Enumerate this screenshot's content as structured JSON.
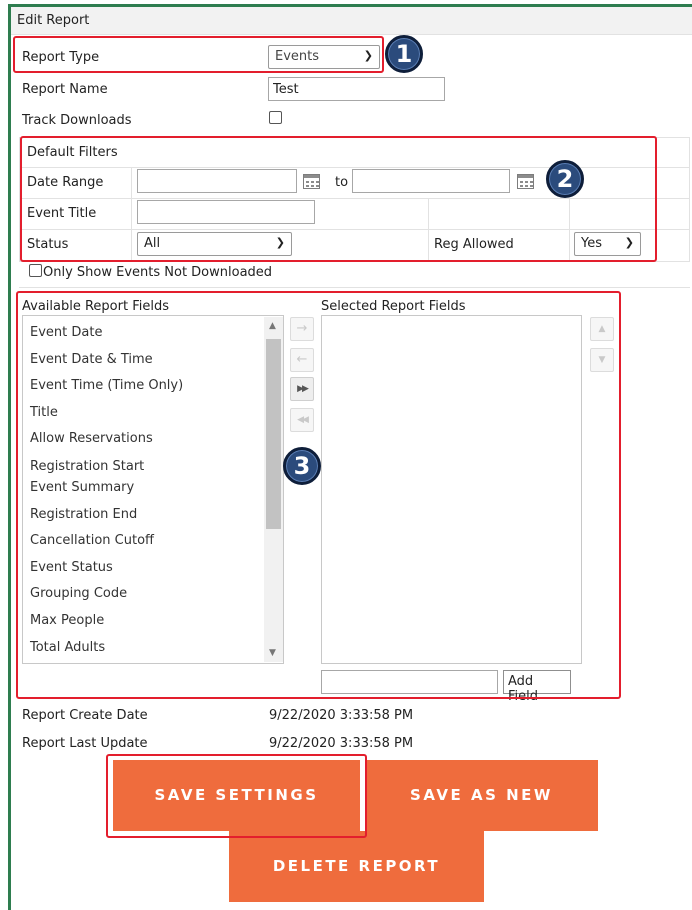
{
  "panel": {
    "title": "Edit Report"
  },
  "report_type": {
    "label": "Report Type",
    "value": "Events"
  },
  "report_name": {
    "label": "Report Name",
    "value": "Test"
  },
  "track_downloads": {
    "label": "Track Downloads",
    "checked": false
  },
  "filters": {
    "heading": "Default Filters",
    "date_range": {
      "label": "Date Range",
      "from_value": "",
      "to_label": "to",
      "to_value": ""
    },
    "event_title": {
      "label": "Event Title",
      "value": ""
    },
    "status": {
      "label": "Status",
      "value": "All"
    },
    "reg_allowed": {
      "label": "Reg Allowed",
      "value": "Yes"
    }
  },
  "only_not_downloaded": {
    "label": "Only Show Events Not Downloaded",
    "checked": false
  },
  "available_fields": {
    "heading": "Available Report Fields",
    "items": [
      "Event Date",
      "Event Date & Time",
      "Event Time (Time Only)",
      "Title",
      "Allow Reservations",
      "Registration Start",
      "Event Summary",
      "Registration End",
      "Cancellation Cutoff",
      "Event Status",
      "Grouping Code",
      "Max People",
      "Total Adults"
    ]
  },
  "selected_fields": {
    "heading": "Selected Report Fields",
    "items": [],
    "add_field_value": "",
    "add_field_button": "Add Field"
  },
  "transfer_buttons": {
    "add": "→",
    "remove": "←",
    "add_all": "▶▶",
    "remove_all": "◀◀"
  },
  "order_buttons": {
    "up": "▲",
    "down": "▼"
  },
  "dates": {
    "create_label": "Report Create Date",
    "create_value": "9/22/2020 3:33:58 PM",
    "update_label": "Report Last Update",
    "update_value": "9/22/2020 3:33:58 PM"
  },
  "actions": {
    "save_settings": "SAVE SETTINGS",
    "save_as_new": "SAVE AS NEW",
    "delete_report": "DELETE REPORT"
  },
  "callouts": {
    "one": "1",
    "two": "2",
    "three": "3"
  },
  "colors": {
    "accent_orange": "#ef6c3d",
    "highlight_red": "#e31e2d",
    "badge_blue": "#2b4b7c",
    "frame_green": "#2e7d4f"
  }
}
